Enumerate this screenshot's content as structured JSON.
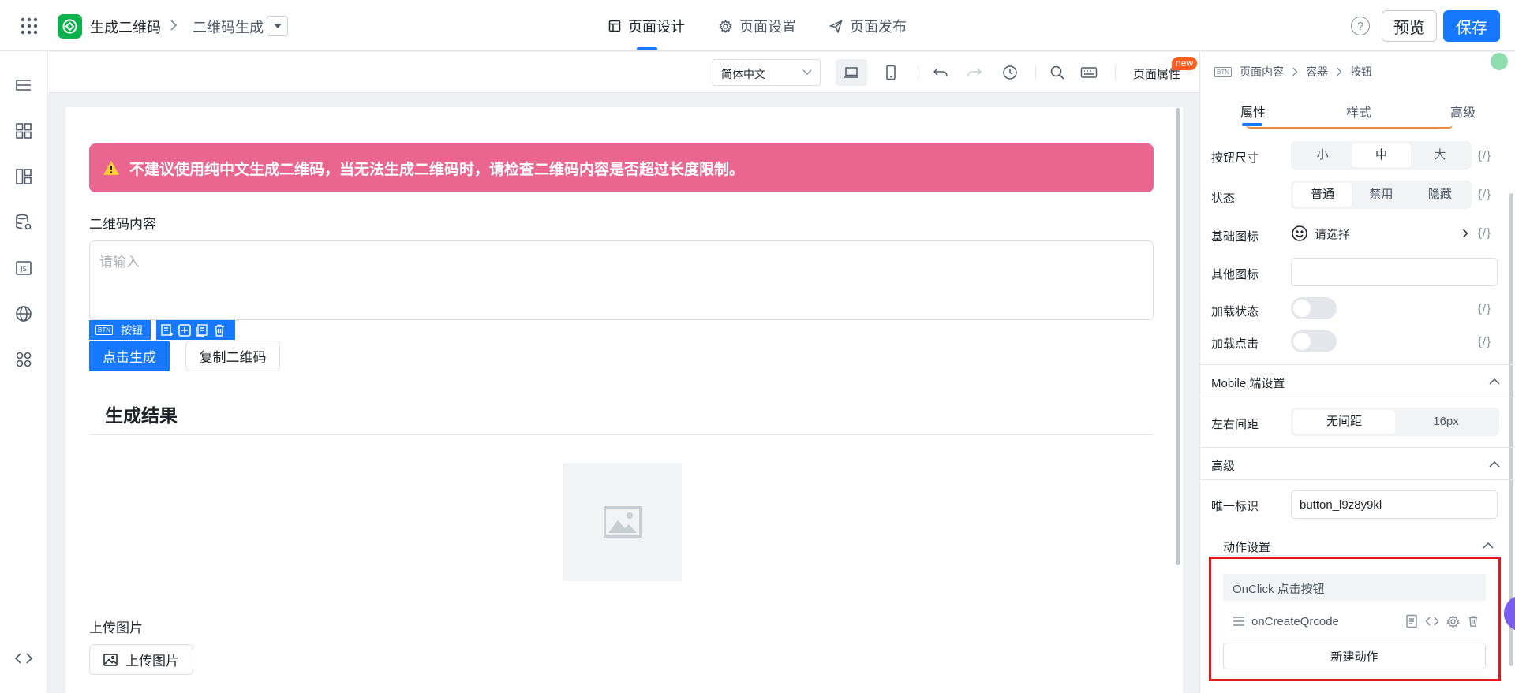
{
  "header": {
    "app_name": "生成二维码",
    "breadcrumb_sep": ">",
    "page_name": "二维码生成",
    "tabs": [
      {
        "label": "页面设计"
      },
      {
        "label": "页面设置"
      },
      {
        "label": "页面发布"
      }
    ],
    "help": "?",
    "preview_label": "预览",
    "save_label": "保存",
    "accent_color": "#1677ff"
  },
  "toolbar": {
    "language": "简体中文",
    "page_attr_label": "页面属性",
    "new_badge": "new"
  },
  "canvas": {
    "alert_text": "不建议使用纯中文生成二维码，当无法生成二维码时，请检查二维码内容是否超过长度限制。",
    "qr_label": "二维码内容",
    "qr_placeholder": "请输入",
    "selected_tag": "按钮",
    "selected_tag_prefix": "BTN",
    "generate_button": "点击生成",
    "copy_button": "复制二维码",
    "result_title": "生成结果",
    "upload_label": "上传图片",
    "upload_button": "上传图片"
  },
  "right_panel": {
    "breadcrumb": [
      "页面内容",
      "容器",
      "按钮"
    ],
    "breadcrumb_prefix": "BTN",
    "tabs": [
      "属性",
      "样式",
      "高级"
    ],
    "props": {
      "size_label": "按钮尺寸",
      "size_options": [
        "小",
        "中",
        "大"
      ],
      "size_selected": "中",
      "state_label": "状态",
      "state_options": [
        "普通",
        "禁用",
        "隐藏"
      ],
      "state_selected": "普通",
      "base_icon_label": "基础图标",
      "base_icon_value": "请选择",
      "other_icon_label": "其他图标",
      "other_icon_value": "",
      "loading_state_label": "加载状态",
      "loading_click_label": "加载点击",
      "var_toggle": "{/}"
    },
    "mobile": {
      "title": "Mobile 端设置",
      "spacing_label": "左右间距",
      "spacing_options": [
        "无间距",
        "16px"
      ],
      "spacing_selected": "无间距"
    },
    "advanced": {
      "title": "高级",
      "id_label": "唯一标识",
      "id_value": "button_l9z8y9kl"
    },
    "actions": {
      "title": "动作设置",
      "event": "OnClick 点击按钮",
      "items": [
        "onCreateQrcode"
      ],
      "new_action": "新建动作"
    }
  }
}
